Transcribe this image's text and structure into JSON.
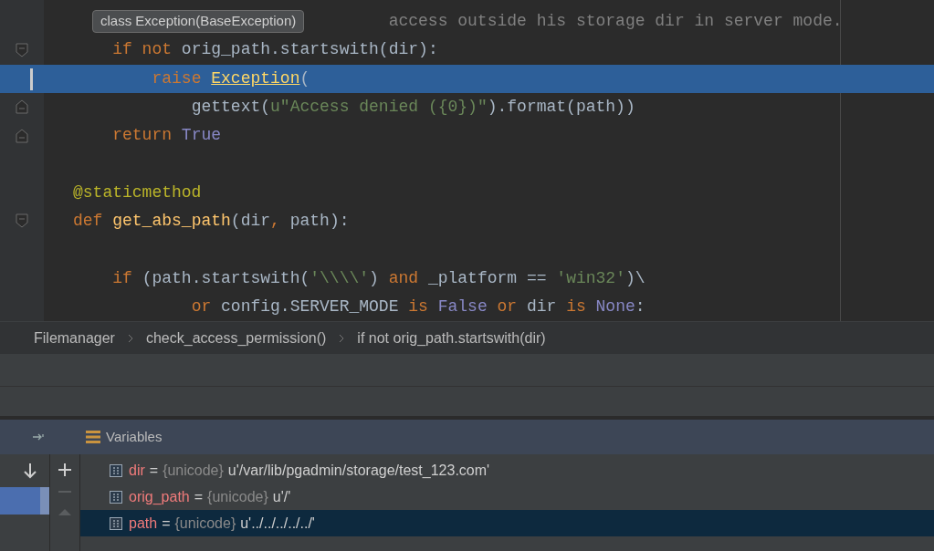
{
  "editor": {
    "lines": [
      {
        "kind": "plain",
        "highlighted": false,
        "tokens": [
          {
            "kind": "comment",
            "text": "                                access outside his storage dir in server mode."
          }
        ]
      },
      {
        "kind": "opener",
        "highlighted": false,
        "tokens": [
          {
            "kind": "keyword",
            "text": "    if not"
          },
          {
            "kind": "default",
            "text": " orig_path.startswith(dir):"
          }
        ]
      },
      {
        "kind": "plain",
        "highlighted": true,
        "tokens": [
          {
            "kind": "keyword",
            "text": "        raise "
          },
          {
            "kind": "link",
            "text": "Exception"
          },
          {
            "kind": "default",
            "text": "("
          }
        ]
      },
      {
        "kind": "closer",
        "highlighted": false,
        "tokens": [
          {
            "kind": "default",
            "text": "            gettext("
          },
          {
            "kind": "string",
            "text": "u\"Access denied ({0})\""
          },
          {
            "kind": "default",
            "text": ").format(path))"
          }
        ]
      },
      {
        "kind": "closer",
        "highlighted": false,
        "tokens": [
          {
            "kind": "keyword",
            "text": "    return "
          },
          {
            "kind": "builtin",
            "text": "True"
          }
        ]
      },
      {
        "kind": "plain",
        "highlighted": false
      },
      {
        "kind": "plain",
        "highlighted": false,
        "tokens": [
          {
            "kind": "decorator",
            "text": "@staticmethod"
          }
        ]
      },
      {
        "kind": "opener",
        "highlighted": false,
        "tokens": [
          {
            "kind": "keyword",
            "text": "def "
          },
          {
            "kind": "func",
            "text": "get_abs_path"
          },
          {
            "kind": "default",
            "text": "(dir"
          },
          {
            "kind": "keyword",
            "text": ","
          },
          {
            "kind": "default",
            "text": " path):"
          }
        ]
      },
      {
        "kind": "plain",
        "highlighted": false
      },
      {
        "kind": "plain",
        "highlighted": false,
        "tokens": [
          {
            "kind": "keyword",
            "text": "    if"
          },
          {
            "kind": "default",
            "text": " (path.startswith("
          },
          {
            "kind": "string",
            "text": "'\\\\\\\\'"
          },
          {
            "kind": "default",
            "text": ") "
          },
          {
            "kind": "keyword",
            "text": "and"
          },
          {
            "kind": "default",
            "text": " _platform == "
          },
          {
            "kind": "string",
            "text": "'win32'"
          },
          {
            "kind": "default",
            "text": ")\\"
          }
        ]
      },
      {
        "kind": "plain",
        "highlighted": false,
        "tokens": [
          {
            "kind": "keyword",
            "text": "            or"
          },
          {
            "kind": "default",
            "text": " config.SERVER_MODE "
          },
          {
            "kind": "keyword",
            "text": "is "
          },
          {
            "kind": "builtin",
            "text": "False"
          },
          {
            "kind": "keyword",
            "text": " or"
          },
          {
            "kind": "default",
            "text": " dir "
          },
          {
            "kind": "keyword",
            "text": "is "
          },
          {
            "kind": "builtin",
            "text": "None"
          },
          {
            "kind": "default",
            "text": ":"
          }
        ]
      }
    ],
    "tooltip": "class Exception(BaseException)"
  },
  "breadcrumbs": [
    "Filemanager",
    "check_access_permission()",
    "if not orig_path.startswith(dir)"
  ],
  "variables": {
    "title": "Variables",
    "rows": [
      {
        "name": "dir",
        "separator": "=",
        "type": "{unicode}",
        "value": "u'/var/lib/pgadmin/storage/test_123.com'",
        "selected": false
      },
      {
        "name": "orig_path",
        "separator": "=",
        "type": "{unicode}",
        "value": "u'/'",
        "selected": false
      },
      {
        "name": "path",
        "separator": "=",
        "type": "{unicode}",
        "value": "u'../../../../../'",
        "selected": true
      }
    ]
  }
}
